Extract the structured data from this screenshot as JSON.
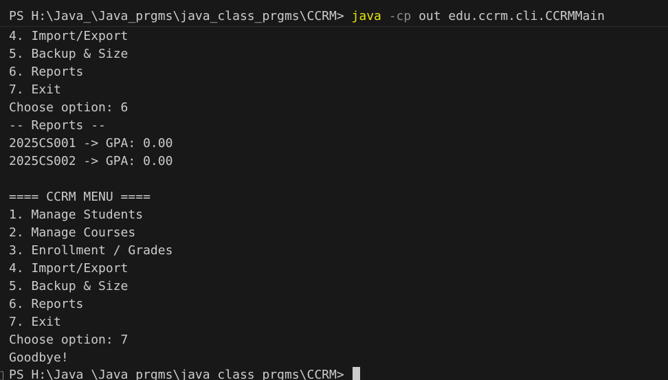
{
  "prompt_top": {
    "prefix": "PS H:\\Java_\\Java_prgms\\java_class_prgms\\CCRM>",
    "command": "java",
    "flag": "-cp",
    "args": "out edu.ccrm.cli.CCRMMain"
  },
  "output_lines": [
    "4. Import/Export",
    "5. Backup & Size",
    "6. Reports",
    "7. Exit",
    "Choose option: 6",
    "-- Reports --",
    "2025CS001 -> GPA: 0.00",
    "2025CS002 -> GPA: 0.00",
    "",
    "==== CCRM MENU ====",
    "1. Manage Students",
    "2. Manage Courses",
    "3. Enrollment / Grades",
    "4. Import/Export",
    "5. Backup & Size",
    "6. Reports",
    "7. Exit",
    "Choose option: 7",
    "Goodbye!"
  ],
  "prompt_bottom": {
    "prefix": "PS H:\\Java_\\Java_prgms\\java_class_prgms\\CCRM>"
  },
  "colors": {
    "background": "#181818",
    "text": "#cccccc",
    "command": "#e5e510",
    "flag": "#8b8b8b"
  }
}
